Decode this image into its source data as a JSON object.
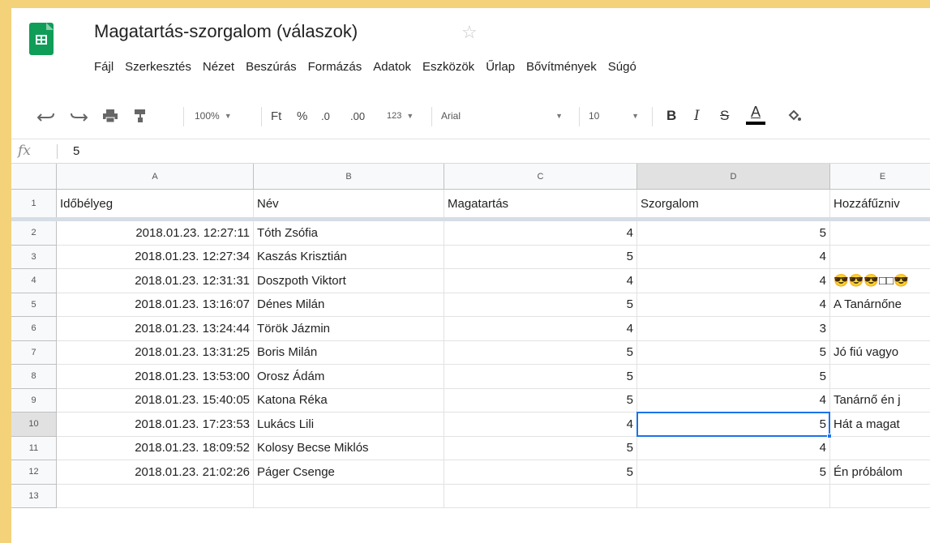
{
  "document": {
    "title": "Magatartás-szorgalom (válaszok)"
  },
  "menu": [
    "Fájl",
    "Szerkesztés",
    "Nézet",
    "Beszúrás",
    "Formázás",
    "Adatok",
    "Eszközök",
    "Űrlap",
    "Bővítmények",
    "Súgó"
  ],
  "toolbar": {
    "zoom": "100%",
    "currency": "Ft",
    "percent": "%",
    "decrease_decimals": ".0",
    "increase_decimals": ".00",
    "more_formats": "123",
    "font": "Arial",
    "font_size": "10",
    "bold": "B",
    "italic": "I",
    "strikethrough": "S",
    "text_color": "A"
  },
  "formula_bar": {
    "label": "fx",
    "value": "5"
  },
  "sheet": {
    "column_headers": [
      "A",
      "B",
      "C",
      "D",
      "E"
    ],
    "row_numbers": [
      "1",
      "2",
      "3",
      "4",
      "5",
      "6",
      "7",
      "8",
      "9",
      "10",
      "11",
      "12",
      "13"
    ],
    "header_row": [
      "Időbélyeg",
      "Név",
      "Magatartás",
      "Szorgalom",
      "Hozzáfűzniv"
    ],
    "rows": [
      [
        "2018.01.23. 12:27:11",
        "Tóth Zsófia",
        "4",
        "5",
        ""
      ],
      [
        "2018.01.23. 12:27:34",
        "Kaszás Krisztián",
        "5",
        "4",
        ""
      ],
      [
        "2018.01.23. 12:31:31",
        "Doszpoth Viktort",
        "4",
        "4",
        "😎😎😎□□😎"
      ],
      [
        "2018.01.23. 13:16:07",
        "Dénes Milán",
        "5",
        "4",
        "A Tanárnőne"
      ],
      [
        "2018.01.23. 13:24:44",
        "Török Jázmin",
        "4",
        "3",
        ""
      ],
      [
        "2018.01.23. 13:31:25",
        "Boris Milán",
        "5",
        "5",
        "Jó fiú vagyo"
      ],
      [
        "2018.01.23. 13:53:00",
        "Orosz Ádám",
        "5",
        "5",
        ""
      ],
      [
        "2018.01.23. 15:40:05",
        "Katona Réka",
        "5",
        "4",
        "Tanárnő én j"
      ],
      [
        "2018.01.23. 17:23:53",
        "Lukács Lili",
        "4",
        "5",
        "Hát a magat"
      ],
      [
        "2018.01.23. 18:09:52",
        "Kolosy Becse Miklós",
        "5",
        "4",
        ""
      ],
      [
        "2018.01.23. 21:02:26",
        "Páger Csenge",
        "5",
        "5",
        "Én próbálom"
      ],
      [
        "",
        "",
        "",
        "",
        ""
      ]
    ],
    "selected_column": "D",
    "selected_row": "10"
  },
  "colors": {
    "accent": "#1a73e8",
    "logo": "#0f9d58",
    "frame": "#f3d27a"
  }
}
